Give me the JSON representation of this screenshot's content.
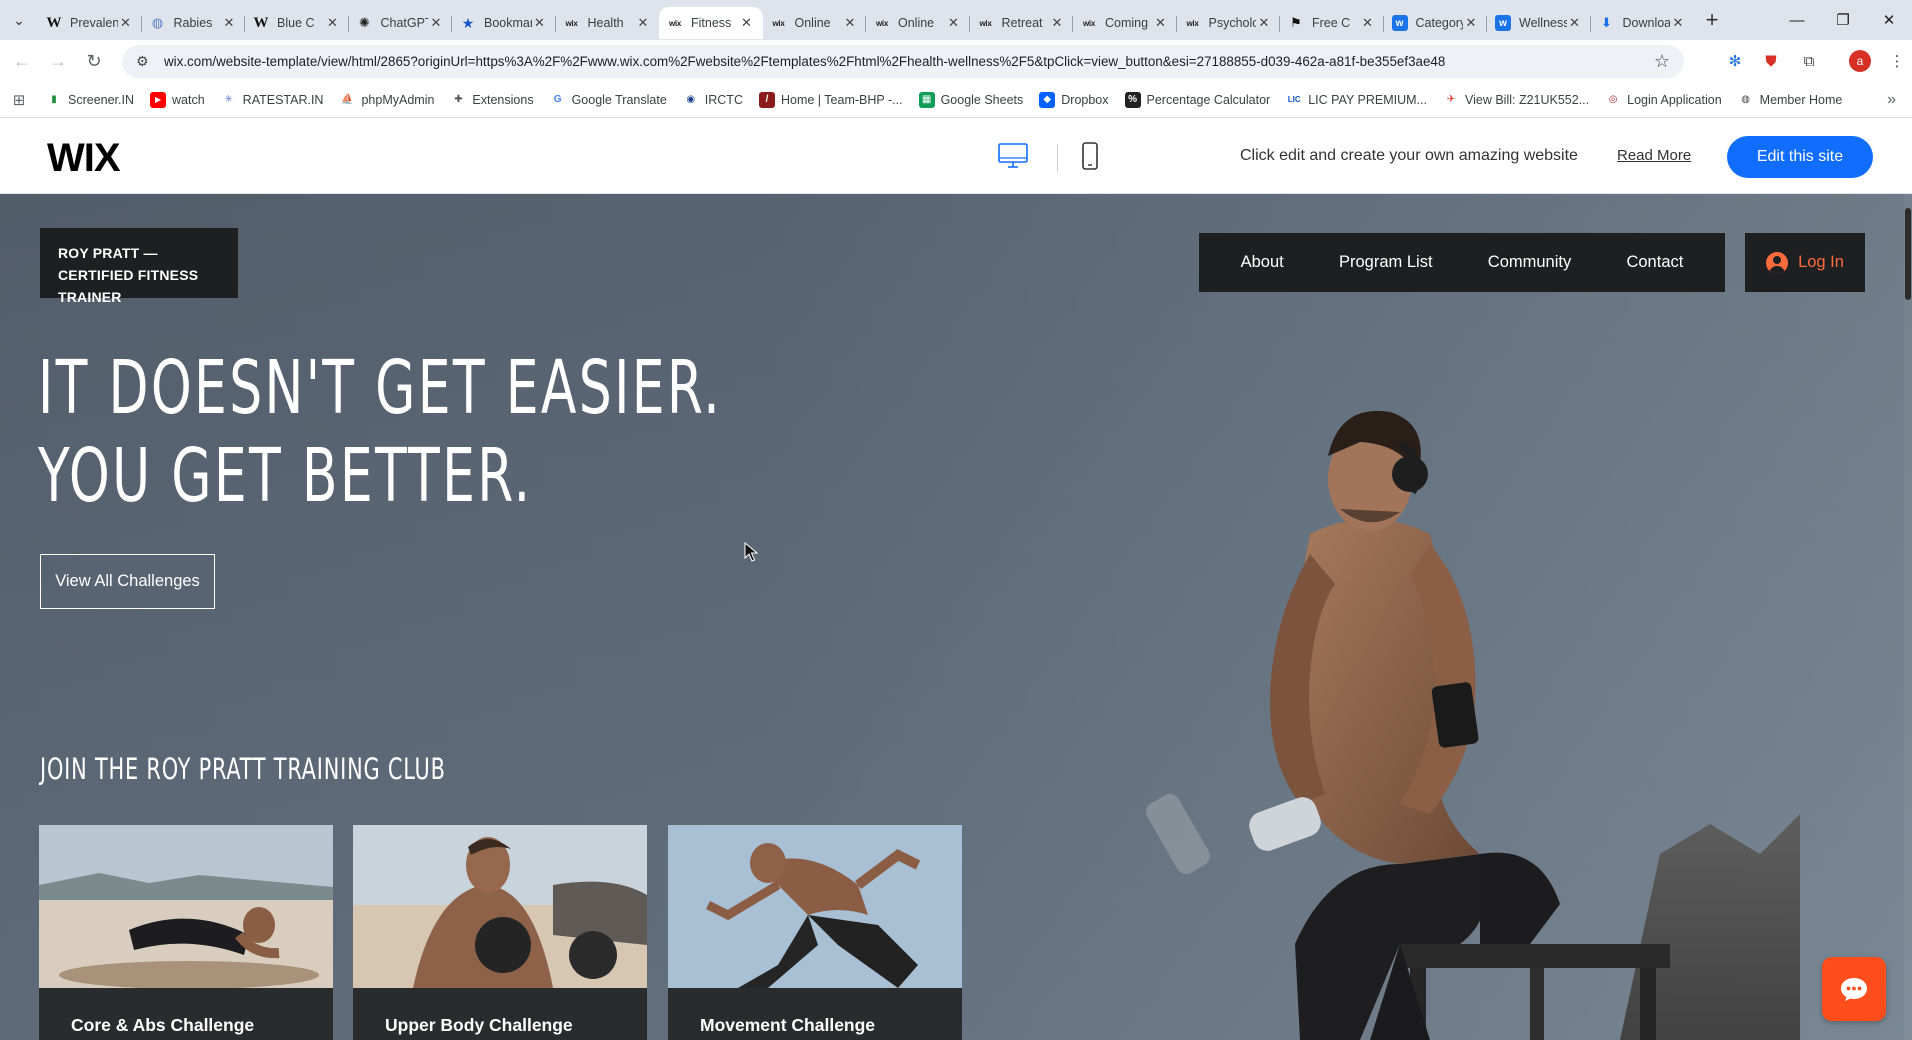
{
  "browser": {
    "tabs": [
      {
        "title": "Prevalence",
        "icon": "wikipedia-icon"
      },
      {
        "title": "Rabies",
        "icon": "globe-icon"
      },
      {
        "title": "Blue C",
        "icon": "wikipedia-icon"
      },
      {
        "title": "ChatGPT",
        "icon": "chatgpt-icon"
      },
      {
        "title": "Bookmarks",
        "icon": "star-icon"
      },
      {
        "title": "Health",
        "icon": "wix-icon"
      },
      {
        "title": "Fitness",
        "icon": "wix-icon"
      },
      {
        "title": "Online",
        "icon": "wix-icon"
      },
      {
        "title": "Online",
        "icon": "wix-icon"
      },
      {
        "title": "Retreat",
        "icon": "wix-icon"
      },
      {
        "title": "Coming",
        "icon": "wix-icon"
      },
      {
        "title": "Psychology",
        "icon": "wix-icon"
      },
      {
        "title": "Free C",
        "icon": "flag-icon"
      },
      {
        "title": "Category",
        "icon": "blue-w-icon"
      },
      {
        "title": "Wellness",
        "icon": "blue-w-icon"
      },
      {
        "title": "Download",
        "icon": "download-icon"
      }
    ],
    "active_tab_index": 6,
    "url": "wix.com/website-template/view/html/2865?originUrl=https%3A%2F%2Fwww.wix.com%2Fwebsite%2Ftemplates%2Fhtml%2Fhealth-wellness%2F5&tpClick=view_button&esi=27188855-d039-462a-a81f-be355ef3ae48",
    "profile_initial": "a",
    "bookmarks": [
      {
        "label": "Screener.IN",
        "icon": "chart-icon"
      },
      {
        "label": "watch",
        "icon": "youtube-icon"
      },
      {
        "label": "RATESTAR.IN",
        "icon": "sparkle-icon"
      },
      {
        "label": "phpMyAdmin",
        "icon": "php-icon"
      },
      {
        "label": "Extensions",
        "icon": "puzzle-icon"
      },
      {
        "label": "Google Translate",
        "icon": "translate-icon"
      },
      {
        "label": "IRCTC",
        "icon": "irctc-icon"
      },
      {
        "label": "Home | Team-BHP -...",
        "icon": "teambhp-icon"
      },
      {
        "label": "Google Sheets",
        "icon": "sheets-icon"
      },
      {
        "label": "Dropbox",
        "icon": "dropbox-icon"
      },
      {
        "label": "Percentage Calculator",
        "icon": "percent-icon"
      },
      {
        "label": "LIC PAY PREMIUM...",
        "icon": "lic-icon"
      },
      {
        "label": "View Bill: Z21UK552...",
        "icon": "bill-icon"
      },
      {
        "label": "Login Application",
        "icon": "login-icon"
      },
      {
        "label": "Member Home",
        "icon": "globe-icon"
      }
    ]
  },
  "wix_bar": {
    "logo": "WIX",
    "message": "Click edit and create your own amazing website",
    "read_more": "Read More",
    "edit_button": "Edit this site"
  },
  "site": {
    "brand_line1": "ROY PRATT —",
    "brand_line2": "CERTIFIED FITNESS TRAINER",
    "nav": [
      "About",
      "Program List",
      "Community",
      "Contact"
    ],
    "login": "Log In",
    "headline_line1": "IT DOESN'T GET EASIER.",
    "headline_line2": "YOU GET BETTER.",
    "cta": "View All Challenges",
    "club_heading": "JOIN THE ROY PRATT TRAINING CLUB",
    "cards": [
      {
        "title": "Core & Abs Challenge"
      },
      {
        "title": "Upper Body Challenge"
      },
      {
        "title": "Movement Challenge"
      }
    ]
  },
  "colors": {
    "wix_blue": "#116dff",
    "login_orange": "#ff6b3d",
    "chat_orange": "#ff4e1b",
    "nav_dark": "#1e1f21"
  }
}
